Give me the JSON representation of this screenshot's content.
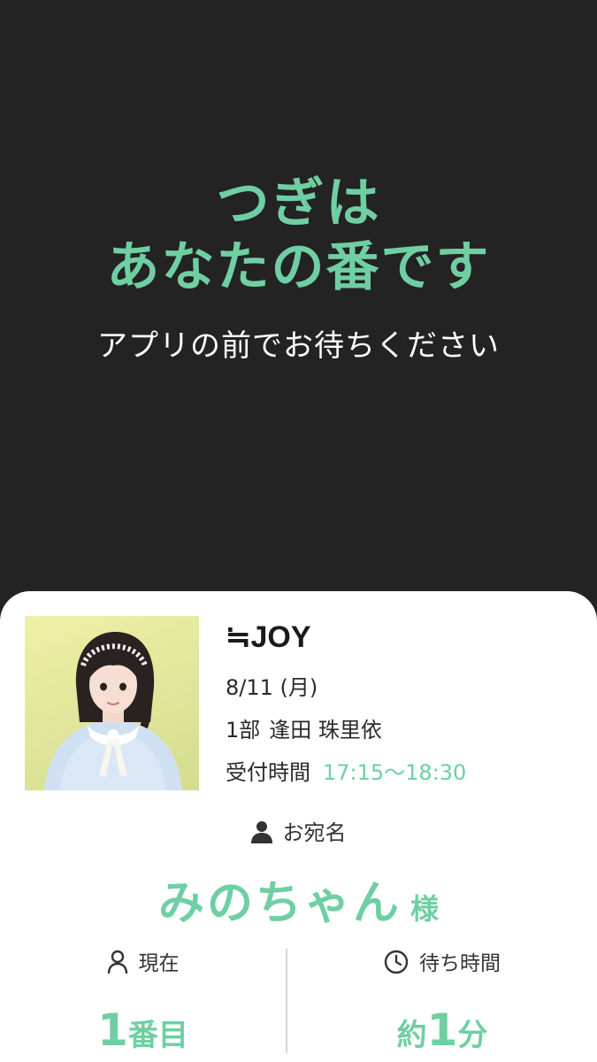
{
  "message": {
    "line1": "つぎは",
    "line2": "あなたの番です",
    "sub": "アプリの前でお待ちください"
  },
  "event": {
    "group": "≒JOY",
    "date": "8/11 (月)",
    "session": "1部",
    "member": "逢田 珠里依",
    "reception_label": "受付時間",
    "reception_time": "17:15〜18:30"
  },
  "recipient": {
    "label": "お宛名",
    "name": "みのちゃん",
    "honorific": "様"
  },
  "status": {
    "current_label": "現在",
    "current_number": "1",
    "current_unit": "番目",
    "wait_label": "待ち時間",
    "wait_prefix": "約",
    "wait_number": "1",
    "wait_unit": "分"
  },
  "colors": {
    "accent": "#6fcfa3",
    "background": "#232323",
    "card": "#ffffff"
  },
  "icons": {
    "recipient": "person-icon",
    "current": "person-outline-icon",
    "wait": "clock-icon"
  }
}
